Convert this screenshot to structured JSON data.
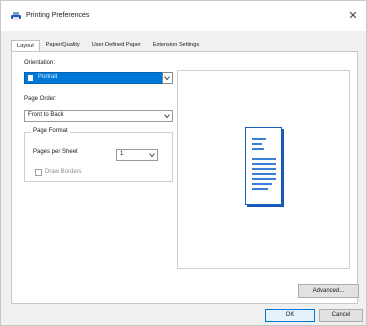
{
  "window": {
    "title": "Printing Preferences",
    "close_icon": "close-icon",
    "app_icon": "printer-icon"
  },
  "tabs": [
    {
      "label": "Layout",
      "active": true
    },
    {
      "label": "Paper/Quality",
      "active": false
    },
    {
      "label": "User Defined Paper",
      "active": false
    },
    {
      "label": "Extension Settings",
      "active": false
    }
  ],
  "layout": {
    "orientation": {
      "label": "Orientation:",
      "selected": "Portrait",
      "icon": "portrait-page-icon"
    },
    "page_order": {
      "label": "Page Order:",
      "selected": "Front to Back"
    },
    "page_format": {
      "legend": "Page Format",
      "pages_per_sheet_label": "Pages per Sheet",
      "pages_per_sheet_value": "1",
      "draw_borders_label": "Draw Borders",
      "draw_borders_checked": false
    }
  },
  "buttons": {
    "advanced": "Advanced...",
    "ok": "OK",
    "cancel": "Cancel"
  },
  "colors": {
    "accent": "#0078d7",
    "preview_page": "#1d5fbf"
  }
}
